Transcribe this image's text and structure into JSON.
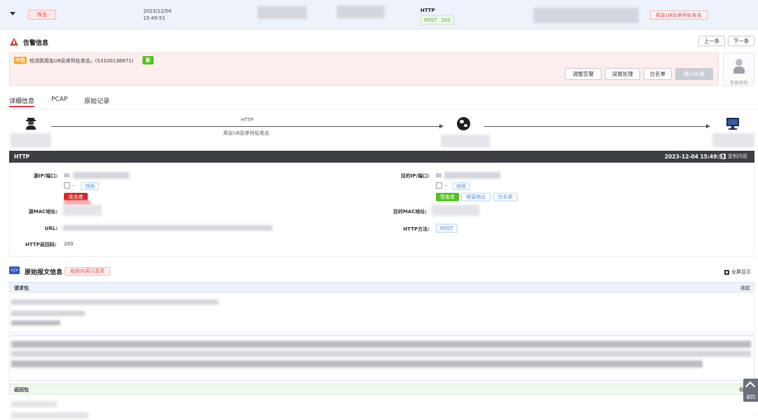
{
  "alert_row": {
    "type_tag": "攻击",
    "date": "2023/12/04",
    "time": "15:49:51",
    "protocol": "HTTP",
    "method": "POST",
    "status": "200",
    "rule_tag": "用友U8反序列化攻击"
  },
  "alert_info": {
    "title": "告警信息",
    "prev_label": "上一条",
    "next_label": "下一条",
    "severity": "中危",
    "message": "检测到用友U8反序列化攻击。(S3100136871)",
    "new_badge": "新",
    "actions": [
      "调整告警",
      "误报处理",
      "白名单",
      "确认处置"
    ],
    "expert_label": "专家研判"
  },
  "tabs": [
    "详细信息",
    "PCAP",
    "原始记录"
  ],
  "flow": {
    "protocol": "HTTP",
    "attack_name": "用友U8反序列化攻击"
  },
  "http_section": {
    "title": "HTTP",
    "timestamp": "2023-12-04 15:49:51",
    "copy_label": "复制内容",
    "src_ip_label": "源IP/端口:",
    "dst_ip_label": "目的IP/端口:",
    "src_port": "--",
    "dst_port": "--",
    "quick_label": "快照",
    "attacker_tag": "攻击者",
    "victim_tag": "受害者",
    "protect_label": "保留地址",
    "whitelist_label": "白名单",
    "src_mac_label": "源MAC地址:",
    "dst_mac_label": "目的MAC地址:",
    "url_label": "URL:",
    "method_label": "HTTP方法:",
    "method_value": "POST",
    "code_label": "HTTP返回码:",
    "code_value": "200"
  },
  "raw_section": {
    "title": "原始报文信息",
    "highlight_badge": "规则内容已高亮",
    "fullscreen_label": "全屏显示",
    "request_label": "请求包",
    "collapse_label": "收起",
    "response_label": "返回包",
    "response_collapse": "收",
    "back_label": "返回"
  }
}
